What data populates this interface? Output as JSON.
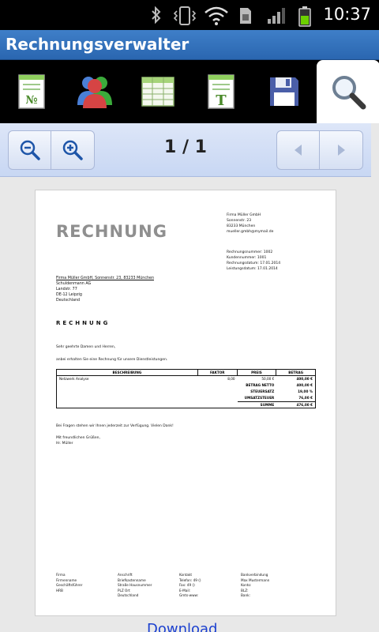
{
  "status_bar": {
    "time": "10:37"
  },
  "app": {
    "title": "Rechnungsverwalter"
  },
  "tabs": [
    {
      "icon": "invoice-number-icon"
    },
    {
      "icon": "customers-icon"
    },
    {
      "icon": "table-icon"
    },
    {
      "icon": "text-document-icon"
    },
    {
      "icon": "save-icon"
    },
    {
      "icon": "search-icon",
      "active": true
    }
  ],
  "pager": {
    "label": "1 / 1"
  },
  "document": {
    "title": "RECHNUNG",
    "sender": [
      "Firma Müller GmbH",
      "Sonnenstr. 23",
      "83233 München",
      "mueller.gmbh@mymail.de"
    ],
    "meta": [
      "Rechnungsnummer: 1002",
      "Kundennummer: 1001",
      "Rechnungsdatum: 17.01.2014",
      "Leistungsdatum: 17.01.2014"
    ],
    "return_line": "Firma Müller GmbH, Sonnenstr. 23, 83233 München",
    "recipient": [
      "Schuldenmann AG",
      "Landstr. 77",
      "DE-12 Leipzig",
      "Deutschland"
    ],
    "heading": "RECHNUNG",
    "salutation": "Sehr geehrte Damen und Herren,",
    "intro": "anbei erhalten Sie eine Rechnung für unsere Dienstleistungen.",
    "table": {
      "headers": [
        "BESCHREIBUNG",
        "FAKTOR",
        "PREIS",
        "BETRAG"
      ],
      "rows": [
        [
          "Netzwerk Analyse",
          "8,00",
          "50,00 €",
          "400,00 €"
        ],
        [
          "",
          "",
          "BETRAG NETTO",
          "400,00 €"
        ],
        [
          "",
          "",
          "STEUERSATZ",
          "19,00 %"
        ],
        [
          "",
          "",
          "UMSATZSTEUER",
          "76,00 €"
        ]
      ],
      "sum": [
        "",
        "",
        "SUMME",
        "476,00 €"
      ]
    },
    "closing": "Bei Fragen stehen wir Ihnen jederzeit zur Verfügung. Vielen Dank!",
    "greeting": [
      "Mit freundlichen Grüßen,",
      "Hr. Müller"
    ],
    "footer": [
      [
        "Firma",
        "Firmenname",
        "Geschäftsführer",
        "HRB"
      ],
      [
        "Anschrift",
        "Briefkastenname",
        "Straße Hausnummer",
        "PLZ Ort",
        "Deutschland"
      ],
      [
        "Kontakt",
        "Telefon: 49 ()",
        "Fax: 49 ()",
        "E-Mail:",
        "Gmts-www:"
      ],
      [
        "Bankverbindung",
        "Max Mustermann",
        "Konto:",
        "BLZ:",
        "Bank:"
      ]
    ]
  },
  "download_link": "Download"
}
